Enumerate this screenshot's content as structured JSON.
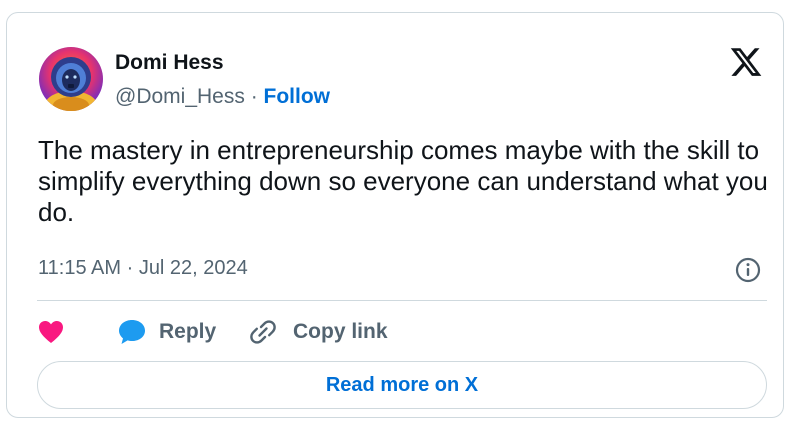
{
  "author": {
    "name": "Domi Hess",
    "handle": "@Domi_Hess",
    "separator": " · ",
    "follow_label": "Follow",
    "avatar_icon": "astronaut-avatar"
  },
  "tweet": {
    "text": "The mastery in entrepreneurship comes maybe with the skill to simplify everything down so everyone can understand what you do.",
    "time": "11:15 AM",
    "time_separator": " · ",
    "date": "Jul 22, 2024"
  },
  "actions": {
    "like_icon": "heart-icon",
    "reply_label": "Reply",
    "copy_link_label": "Copy link"
  },
  "footer": {
    "read_more_label": "Read more on X"
  },
  "colors": {
    "like": "#f91880",
    "reply": "#1d9bf0",
    "link_blue": "#006fd6",
    "secondary_text": "#536471",
    "border": "#cfd9de"
  }
}
